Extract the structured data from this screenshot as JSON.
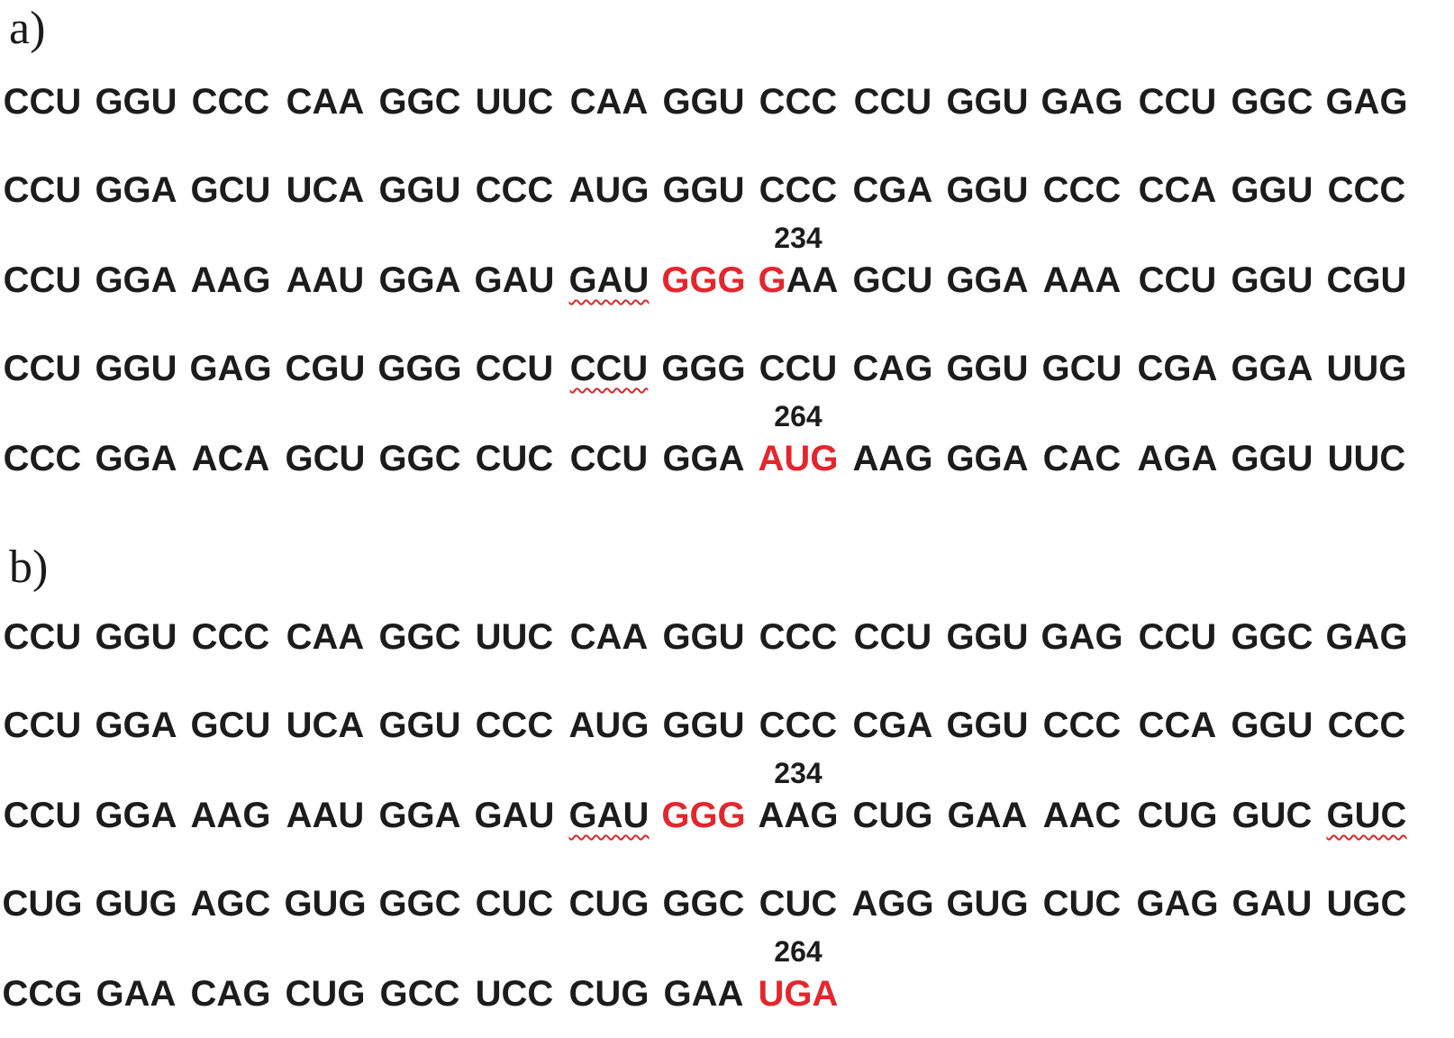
{
  "panels": [
    {
      "label": "a)",
      "rows": [
        {
          "codons": [
            {
              "t": "CCU"
            },
            {
              "t": "GGU"
            },
            {
              "t": "CCC"
            },
            {
              "t": "CAA"
            },
            {
              "t": "GGC"
            },
            {
              "t": "UUC"
            },
            {
              "t": "CAA"
            },
            {
              "t": "GGU"
            },
            {
              "t": "CCC"
            },
            {
              "t": "CCU"
            },
            {
              "t": "GGU"
            },
            {
              "t": "GAG"
            },
            {
              "t": "CCU"
            },
            {
              "t": "GGC"
            },
            {
              "t": "GAG"
            }
          ]
        },
        {
          "codons": [
            {
              "t": "CCU"
            },
            {
              "t": "GGA"
            },
            {
              "t": "GCU"
            },
            {
              "t": "UCA"
            },
            {
              "t": "GGU"
            },
            {
              "t": "CCC"
            },
            {
              "t": "AUG"
            },
            {
              "t": "GGU"
            },
            {
              "t": "CCC"
            },
            {
              "t": "CGA"
            },
            {
              "t": "GGU"
            },
            {
              "t": "CCC"
            },
            {
              "t": "CCA"
            },
            {
              "t": "GGU"
            },
            {
              "t": "CCC"
            }
          ]
        },
        {
          "marker": {
            "col": 8,
            "text": "234"
          },
          "codons": [
            {
              "t": "CCU"
            },
            {
              "t": "GGA"
            },
            {
              "t": "AAG"
            },
            {
              "t": "AAU"
            },
            {
              "t": "GGA"
            },
            {
              "t": "GAU"
            },
            {
              "t": "GAU",
              "squiggle": true
            },
            {
              "t": "GGG",
              "red": 3
            },
            {
              "t": "GAA",
              "red": 1
            },
            {
              "t": "GCU"
            },
            {
              "t": "GGA"
            },
            {
              "t": "AAA"
            },
            {
              "t": "CCU"
            },
            {
              "t": "GGU"
            },
            {
              "t": "CGU"
            }
          ]
        },
        {
          "codons": [
            {
              "t": "CCU"
            },
            {
              "t": "GGU"
            },
            {
              "t": "GAG"
            },
            {
              "t": "CGU"
            },
            {
              "t": "GGG"
            },
            {
              "t": "CCU"
            },
            {
              "t": "CCU",
              "squiggle": true
            },
            {
              "t": "GGG"
            },
            {
              "t": "CCU"
            },
            {
              "t": "CAG"
            },
            {
              "t": "GGU"
            },
            {
              "t": "GCU"
            },
            {
              "t": "CGA"
            },
            {
              "t": "GGA"
            },
            {
              "t": "UUG"
            }
          ]
        },
        {
          "marker": {
            "col": 8,
            "text": "264"
          },
          "codons": [
            {
              "t": "CCC"
            },
            {
              "t": "GGA"
            },
            {
              "t": "ACA"
            },
            {
              "t": "GCU"
            },
            {
              "t": "GGC"
            },
            {
              "t": "CUC"
            },
            {
              "t": "CCU"
            },
            {
              "t": "GGA"
            },
            {
              "t": "AUG",
              "red": 3
            },
            {
              "t": "AAG"
            },
            {
              "t": "GGA"
            },
            {
              "t": "CAC"
            },
            {
              "t": "AGA"
            },
            {
              "t": "GGU"
            },
            {
              "t": "UUC"
            }
          ]
        }
      ]
    },
    {
      "label": "b)",
      "rows": [
        {
          "codons": [
            {
              "t": "CCU"
            },
            {
              "t": "GGU"
            },
            {
              "t": "CCC"
            },
            {
              "t": "CAA"
            },
            {
              "t": "GGC"
            },
            {
              "t": "UUC"
            },
            {
              "t": "CAA"
            },
            {
              "t": "GGU"
            },
            {
              "t": "CCC"
            },
            {
              "t": "CCU"
            },
            {
              "t": "GGU"
            },
            {
              "t": "GAG"
            },
            {
              "t": "CCU"
            },
            {
              "t": "GGC"
            },
            {
              "t": "GAG"
            }
          ]
        },
        {
          "codons": [
            {
              "t": "CCU"
            },
            {
              "t": "GGA"
            },
            {
              "t": "GCU"
            },
            {
              "t": "UCA"
            },
            {
              "t": "GGU"
            },
            {
              "t": "CCC"
            },
            {
              "t": "AUG"
            },
            {
              "t": "GGU"
            },
            {
              "t": "CCC"
            },
            {
              "t": "CGA"
            },
            {
              "t": "GGU"
            },
            {
              "t": "CCC"
            },
            {
              "t": "CCA"
            },
            {
              "t": "GGU"
            },
            {
              "t": "CCC"
            }
          ]
        },
        {
          "marker": {
            "col": 8,
            "text": "234"
          },
          "codons": [
            {
              "t": "CCU"
            },
            {
              "t": "GGA"
            },
            {
              "t": "AAG"
            },
            {
              "t": "AAU"
            },
            {
              "t": "GGA"
            },
            {
              "t": "GAU"
            },
            {
              "t": "GAU",
              "squiggle": true
            },
            {
              "t": "GGG",
              "red": 3
            },
            {
              "t": "AAG"
            },
            {
              "t": "CUG"
            },
            {
              "t": "GAA"
            },
            {
              "t": "AAC"
            },
            {
              "t": "CUG"
            },
            {
              "t": "GUC"
            },
            {
              "t": "GUC",
              "squiggle": true
            }
          ]
        },
        {
          "codons": [
            {
              "t": "CUG"
            },
            {
              "t": "GUG"
            },
            {
              "t": "AGC"
            },
            {
              "t": "GUG"
            },
            {
              "t": "GGC"
            },
            {
              "t": "CUC"
            },
            {
              "t": "CUG"
            },
            {
              "t": "GGC"
            },
            {
              "t": "CUC"
            },
            {
              "t": "AGG"
            },
            {
              "t": "GUG"
            },
            {
              "t": "CUC"
            },
            {
              "t": "GAG"
            },
            {
              "t": "GAU"
            },
            {
              "t": "UGC"
            }
          ]
        },
        {
          "marker": {
            "col": 8,
            "text": "264"
          },
          "codons": [
            {
              "t": "CCG"
            },
            {
              "t": "GAA"
            },
            {
              "t": "CAG"
            },
            {
              "t": "CUG"
            },
            {
              "t": "GCC"
            },
            {
              "t": "UCC"
            },
            {
              "t": "CUG"
            },
            {
              "t": "GAA"
            },
            {
              "t": "UGA",
              "red": 3
            }
          ]
        }
      ]
    }
  ],
  "colors": {
    "text": "#1c1c1c",
    "highlight": "#e3262d",
    "spellcheck": "#d42a2a"
  }
}
